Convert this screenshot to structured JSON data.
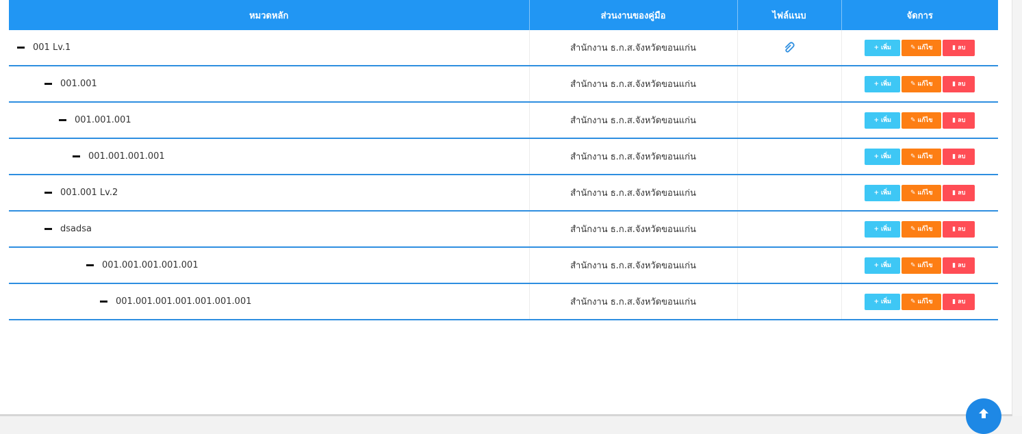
{
  "table": {
    "headers": [
      "หมวดหลัก",
      "ส่วนงานของคู่มือ",
      "ไฟล์แนบ",
      "จัดการ"
    ],
    "actions": {
      "add_label": "เพิ่ม",
      "edit_label": "แก้ไข",
      "delete_label": "ลบ"
    },
    "rows": [
      {
        "name": "001 Lv.1",
        "department": "สำนักงาน ธ.ก.ส.จังหวัดขอนแก่น",
        "has_attachment": true
      },
      {
        "name": "001.001",
        "department": "สำนักงาน ธ.ก.ส.จังหวัดขอนแก่น",
        "has_attachment": false
      },
      {
        "name": "001.001.001",
        "department": "สำนักงาน ธ.ก.ส.จังหวัดขอนแก่น",
        "has_attachment": false
      },
      {
        "name": "001.001.001.001",
        "department": "สำนักงาน ธ.ก.ส.จังหวัดขอนแก่น",
        "has_attachment": false
      },
      {
        "name": "001.001 Lv.2",
        "department": "สำนักงาน ธ.ก.ส.จังหวัดขอนแก่น",
        "has_attachment": false
      },
      {
        "name": "dsadsa",
        "department": "สำนักงาน ธ.ก.ส.จังหวัดขอนแก่น",
        "has_attachment": false
      },
      {
        "name": "001.001.001.001.001",
        "department": "สำนักงาน ธ.ก.ส.จังหวัดขอนแก่น",
        "has_attachment": false
      },
      {
        "name": "001.001.001.001.001.001.001",
        "department": "สำนักงาน ธ.ก.ส.จังหวัดขอนแก่น",
        "has_attachment": false
      }
    ]
  },
  "icons": {
    "collapse": "minus-icon",
    "attachment": "paperclip-icon",
    "add": "plus-icon",
    "edit": "pencil-icon",
    "delete": "trash-icon",
    "scroll_top": "arrow-up-icon"
  },
  "colors": {
    "header": "#2196f3",
    "row_border": "#2d8ee0",
    "add_button": "#3ec7f5",
    "edit_button": "#fd7e14",
    "delete_button": "#ff4d55",
    "fab": "#1e88e5"
  }
}
